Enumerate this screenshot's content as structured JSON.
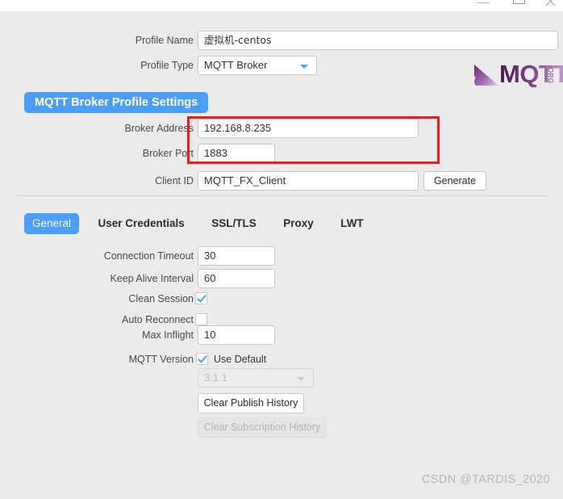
{
  "window": {
    "controls": [
      {
        "name": "minimize",
        "glyph": "minimize-icon"
      },
      {
        "name": "maximize",
        "glyph": "maximize-icon"
      },
      {
        "name": "close",
        "glyph": "close-icon"
      }
    ]
  },
  "colors": {
    "accent_blue": "#4a9df8",
    "panel_bg": "#ebebeb",
    "field_bg": "#ffffff",
    "annotation_red": "#ec1c1c",
    "label_text": "#4a4a4a",
    "disabled_text": "#b2b2b2",
    "logo_purple": "#6e3f7e"
  },
  "profile": {
    "name_label": "Profile Name",
    "name_value": "虚拟机-centos",
    "name_placeholder": "",
    "type_label": "Profile Type",
    "type_value": "MQTT Broker",
    "type_options": [
      "MQTT Broker"
    ]
  },
  "logo": {
    "wordmark": "MQTT",
    "suffix": ".ORG",
    "alt": "mqtt-org-logo"
  },
  "section": {
    "header": "MQTT Broker Profile Settings"
  },
  "broker": {
    "address_label": "Broker Address",
    "address_value": "192.168.8.235",
    "port_label": "Broker Port",
    "port_value": "1883",
    "client_id_label": "Client ID",
    "client_id_value": "MQTT_FX_Client",
    "generate_label": "Generate"
  },
  "tabs": [
    {
      "label": "General",
      "active": true
    },
    {
      "label": "User Credentials",
      "active": false
    },
    {
      "label": "SSL/TLS",
      "active": false
    },
    {
      "label": "Proxy",
      "active": false
    },
    {
      "label": "LWT",
      "active": false
    }
  ],
  "general": {
    "connection_timeout_label": "Connection Timeout",
    "connection_timeout_value": "30",
    "keep_alive_label": "Keep Alive Interval",
    "keep_alive_value": "60",
    "clean_session_label": "Clean Session",
    "clean_session_checked": true,
    "auto_reconnect_label": "Auto Reconnect",
    "auto_reconnect_checked": false,
    "max_inflight_label": "Max Inflight",
    "max_inflight_value": "10",
    "mqtt_version_label": "MQTT Version",
    "use_default_label": "Use Default",
    "use_default_checked": true,
    "version_value": "3.1.1",
    "version_options": [
      "3.1.1"
    ],
    "version_disabled": true,
    "clear_publish_label": "Clear Publish History",
    "clear_publish_disabled": false,
    "clear_subscription_label": "Clear Subscription History",
    "clear_subscription_disabled": true
  },
  "watermark": "CSDN @TARDIS_2020"
}
